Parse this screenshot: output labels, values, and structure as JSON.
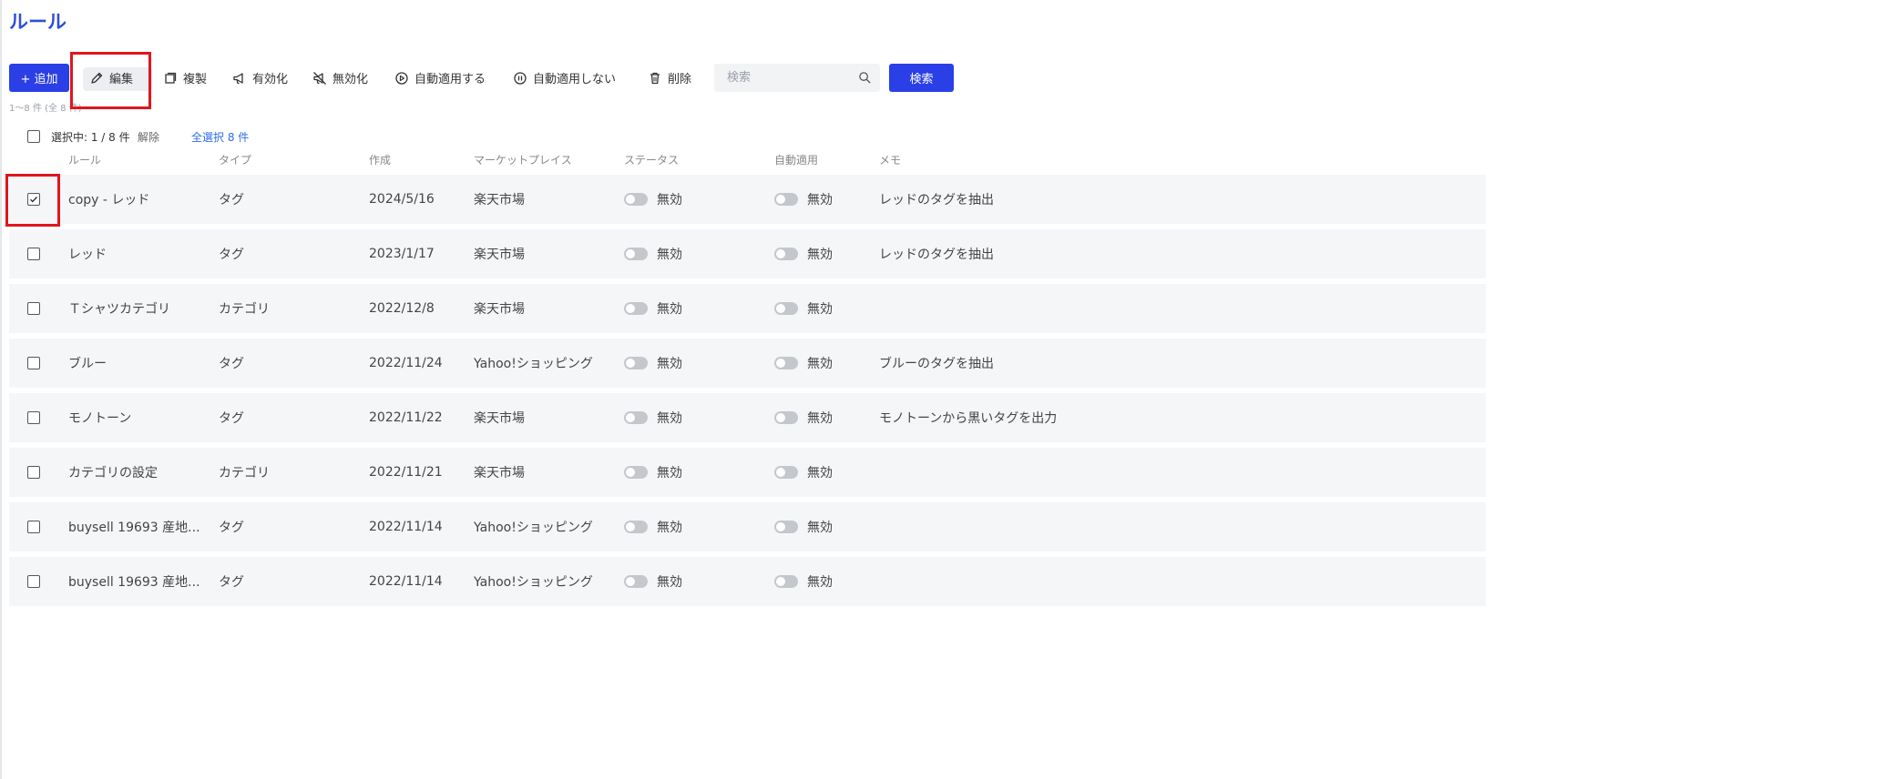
{
  "page": {
    "title": "ルール"
  },
  "toolbar": {
    "add_label": "+ 追加",
    "edit_label": "編集",
    "duplicate_label": "複製",
    "enable_label": "有効化",
    "disable_label": "無効化",
    "auto_apply_label": "自動適用する",
    "no_auto_apply_label": "自動適用しない",
    "delete_label": "削除",
    "search_placeholder": "検索",
    "search_button": "検索"
  },
  "summary": {
    "count_text": "1～8 件 (全 8 件)",
    "selected_text": "選択中: 1 / 8 件",
    "clear_label": "解除",
    "select_all_label": "全選択 8 件"
  },
  "table": {
    "headers": {
      "rule": "ルール",
      "type": "タイプ",
      "created": "作成",
      "marketplace": "マーケットプレイス",
      "status": "ステータス",
      "auto_apply": "自動適用",
      "memo": "メモ"
    },
    "rows": [
      {
        "checked": true,
        "rule": "copy - レッド",
        "type": "タグ",
        "created": "2024/5/16",
        "marketplace": "楽天市場",
        "status": "無効",
        "auto_apply": "無効",
        "memo": "レッドのタグを抽出"
      },
      {
        "checked": false,
        "rule": "レッド",
        "type": "タグ",
        "created": "2023/1/17",
        "marketplace": "楽天市場",
        "status": "無効",
        "auto_apply": "無効",
        "memo": "レッドのタグを抽出"
      },
      {
        "checked": false,
        "rule": "Ｔシャツカテゴリ",
        "type": "カテゴリ",
        "created": "2022/12/8",
        "marketplace": "楽天市場",
        "status": "無効",
        "auto_apply": "無効",
        "memo": ""
      },
      {
        "checked": false,
        "rule": "ブルー",
        "type": "タグ",
        "created": "2022/11/24",
        "marketplace": "Yahoo!ショッピング",
        "status": "無効",
        "auto_apply": "無効",
        "memo": "ブルーのタグを抽出"
      },
      {
        "checked": false,
        "rule": "モノトーン",
        "type": "タグ",
        "created": "2022/11/22",
        "marketplace": "楽天市場",
        "status": "無効",
        "auto_apply": "無効",
        "memo": "モノトーンから黒いタグを出力"
      },
      {
        "checked": false,
        "rule": "カテゴリの設定",
        "type": "カテゴリ",
        "created": "2022/11/21",
        "marketplace": "楽天市場",
        "status": "無効",
        "auto_apply": "無効",
        "memo": ""
      },
      {
        "checked": false,
        "rule": "buysell 19693 産地...",
        "type": "タグ",
        "created": "2022/11/14",
        "marketplace": "Yahoo!ショッピング",
        "status": "無効",
        "auto_apply": "無効",
        "memo": ""
      },
      {
        "checked": false,
        "rule": "buysell 19693 産地...",
        "type": "タグ",
        "created": "2022/11/14",
        "marketplace": "Yahoo!ショッピング",
        "status": "無効",
        "auto_apply": "無効",
        "memo": ""
      }
    ]
  },
  "colors": {
    "accent": "#2a3fe6",
    "highlight": "#e0161c",
    "row_bg": "#f5f6f8"
  }
}
